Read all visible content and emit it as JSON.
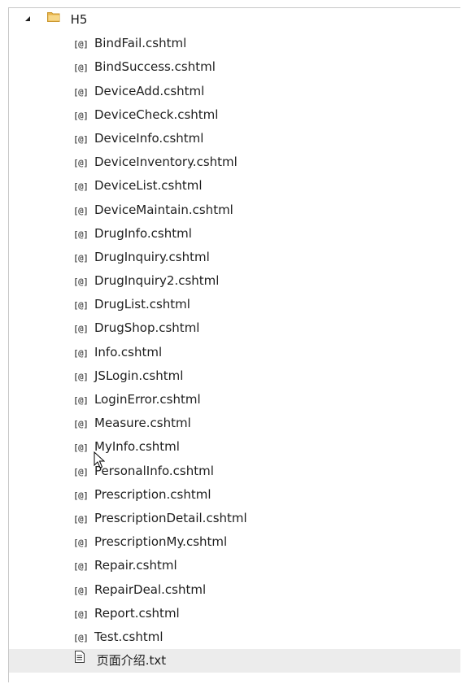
{
  "folder": {
    "name": "H5",
    "expanded": true
  },
  "razor_icon_text": "[@]",
  "files": [
    "BindFail.cshtml",
    "BindSuccess.cshtml",
    "DeviceAdd.cshtml",
    "DeviceCheck.cshtml",
    "DeviceInfo.cshtml",
    "DeviceInventory.cshtml",
    "DeviceList.cshtml",
    "DeviceMaintain.cshtml",
    "DrugInfo.cshtml",
    "DrugInquiry.cshtml",
    "DrugInquiry2.cshtml",
    "DrugList.cshtml",
    "DrugShop.cshtml",
    "Info.cshtml",
    "JSLogin.cshtml",
    "LoginError.cshtml",
    "Measure.cshtml",
    "MyInfo.cshtml",
    "PersonalInfo.cshtml",
    "Prescription.cshtml",
    "PrescriptionDetail.cshtml",
    "PrescriptionMy.cshtml",
    "Repair.cshtml",
    "RepairDeal.cshtml",
    "Report.cshtml",
    "Test.cshtml"
  ],
  "text_file": {
    "name": "页面介绍.txt",
    "selected": true
  },
  "colors": {
    "folder": "#e8b44a",
    "selection": "#ececec",
    "text": "#1e1e1e"
  }
}
